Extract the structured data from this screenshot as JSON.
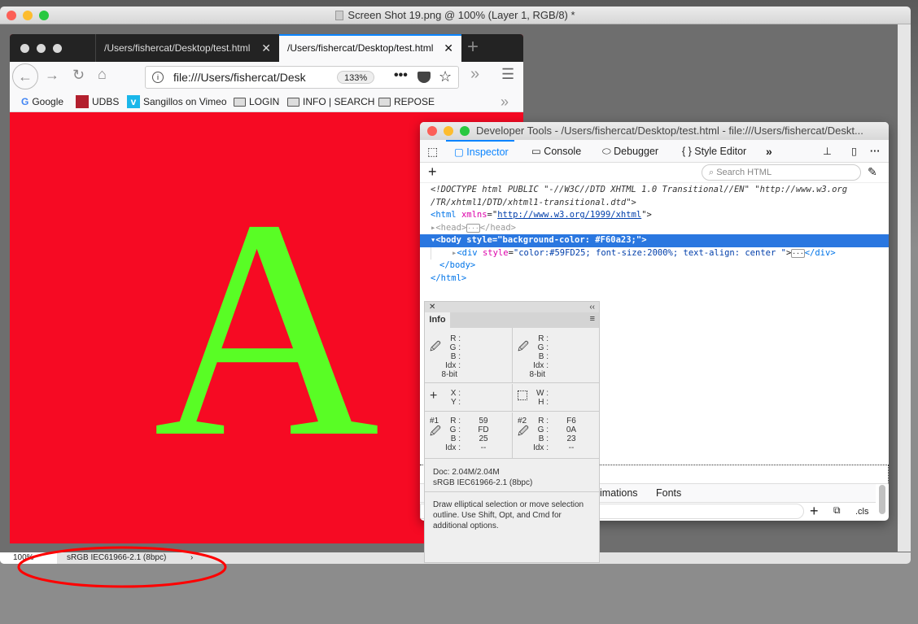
{
  "photoshop": {
    "title": "Screen Shot 19.png @ 100% (Layer 1, RGB/8) *",
    "zoom": "100%",
    "profile": "sRGB IEC61966-2.1 (8bpc)",
    "more_arrow": "›"
  },
  "browser": {
    "tabs": [
      {
        "label": "/Users/fishercat/Desktop/test.html",
        "active": false
      },
      {
        "label": "/Users/fishercat/Desktop/test.html",
        "active": true
      }
    ],
    "url": "file:///Users/fishercat/Desk",
    "zoom": "133%",
    "bookmarks": [
      {
        "label": "Google",
        "icon": "google-icon"
      },
      {
        "label": "UDBS",
        "icon": "udbs-icon"
      },
      {
        "label": "Sangillos on Vimeo",
        "icon": "vimeo-icon"
      },
      {
        "label": "LOGIN",
        "icon": "folder-icon"
      },
      {
        "label": "INFO | SEARCH",
        "icon": "folder-icon"
      },
      {
        "label": "REPOSE",
        "icon": "folder-icon"
      }
    ],
    "content_letter": "A",
    "bg_color": "#F60A23",
    "text_color": "#59FD25"
  },
  "devtools": {
    "title": "Developer Tools - /Users/fishercat/Desktop/test.html - file:///Users/fishercat/Deskt...",
    "tabs": [
      "Inspector",
      "Console",
      "Debugger",
      "Style Editor"
    ],
    "search_placeholder": "Search HTML",
    "markup": {
      "doctype1": "<!DOCTYPE html PUBLIC \"-//W3C//DTD XHTML 1.0 Transitional//EN\" \"http://www.w3.org",
      "doctype2": "/TR/xhtml1/DTD/xhtml1-transitional.dtd\">",
      "html_open": "<html",
      "xmlns_attr": "xmlns",
      "xmlns_val": "http://www.w3.org/1999/xhtml",
      "head": "<head>",
      "head_close": "</head>",
      "body": "<body style=\"background-color: #F60a23;\">",
      "div_open": "<div",
      "div_attr": "style",
      "div_val": "\"color:#59FD25; font-size:2000%; text-align: center \"",
      "div_close": "</div>",
      "body_close": "</body>",
      "html_close": "</html>"
    },
    "bottom_tabs": [
      "imations",
      "Fonts"
    ],
    "cls_label": ".cls"
  },
  "info_panel": {
    "tab": "Info",
    "labels": {
      "r": "R :",
      "g": "G :",
      "b": "B :",
      "idx": "Idx :",
      "bit": "8-bit",
      "x": "X :",
      "y": "Y :",
      "w": "W :",
      "h": "H :"
    },
    "sample1": {
      "label": "#1",
      "r": "59",
      "g": "FD",
      "b": "25",
      "idx": "--"
    },
    "sample2": {
      "label": "#2",
      "r": "F6",
      "g": "0A",
      "b": "23",
      "idx": "--"
    },
    "doc": "Doc: 2.04M/2.04M",
    "profile": "sRGB IEC61966-2.1 (8bpc)",
    "hint": "Draw elliptical selection or move selection outline.  Use Shift, Opt, and Cmd for additional options."
  },
  "annotation_color": "#ff0000"
}
